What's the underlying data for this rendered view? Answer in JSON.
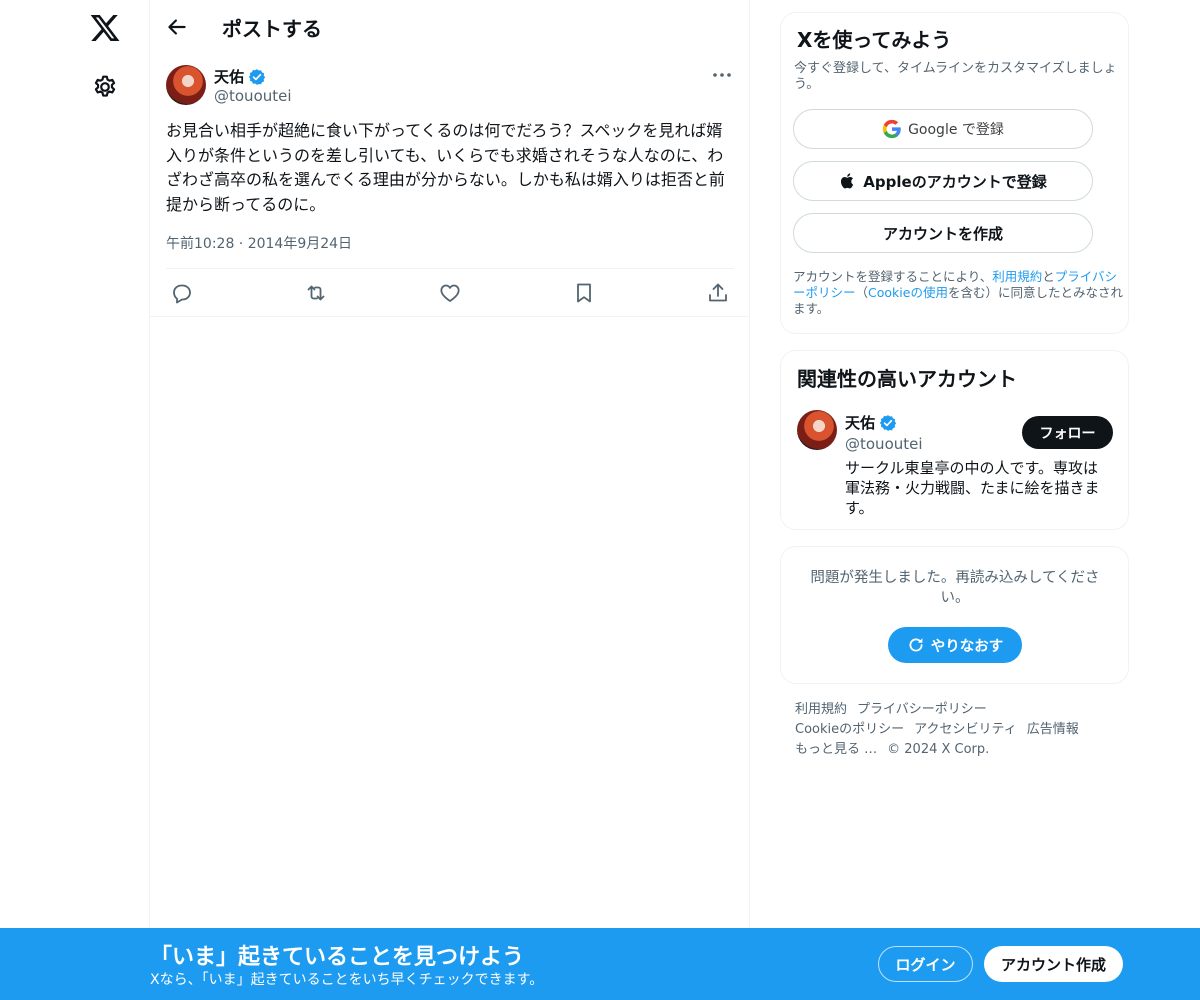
{
  "nav": {
    "logo_icon": "x-logo-icon",
    "settings_icon": "gear-icon"
  },
  "header": {
    "title": "ポストする",
    "back_icon": "arrow-left-icon"
  },
  "post": {
    "author_name": "天佑",
    "author_handle": "@tououtei",
    "verified": true,
    "text": "お見合い相手が超絶に食い下がってくるのは何でだろう？スペックを見れば婿入りが条件というのを差し引いても、いくらでも求婚されそうな人なのに、わざわざ高卒の私を選んでくる理由が分からない。しかも私は婿入りは拒否と前提から断ってるのに。",
    "timestamp": "午前10:28 · 2014年9月24日",
    "actions": [
      "reply-icon",
      "repost-icon",
      "like-icon",
      "bookmark-icon",
      "share-icon"
    ]
  },
  "signup_card": {
    "title": "Xを使ってみよう",
    "subtitle": "今すぐ登録して、タイムラインをカスタマイズしましょう。",
    "google_label": "Google で登録",
    "apple_label": "Appleのアカウントで登録",
    "create_label": "アカウントを作成",
    "legal_prefix": "アカウントを登録することにより、",
    "legal_terms": "利用規約",
    "legal_and": "と",
    "legal_privacy": "プライバシーポリシー",
    "legal_paren_open": "（",
    "legal_cookie": "Cookieの使用",
    "legal_suffix": "を含む）に同意したとみなされます。"
  },
  "related_card": {
    "title": "関連性の高いアカウント",
    "name": "天佑",
    "handle": "@tououtei",
    "follow_label": "フォロー",
    "bio": "サークル東皇亭の中の人です。専攻は軍法務・火力戦闘、たまに絵を描きます。"
  },
  "error_card": {
    "message": "問題が発生しました。再読み込みしてください。",
    "retry_label": "やりなおす"
  },
  "footer": {
    "links": [
      "利用規約",
      "プライバシーポリシー",
      "Cookieのポリシー",
      "アクセシビリティ",
      "広告情報",
      "もっと見る …"
    ],
    "copyright": "© 2024 X Corp."
  },
  "banner": {
    "title": "「いま」起きていることを見つけよう",
    "subtitle": "Xなら、「いま」起きていることをいち早くチェックできます。",
    "login_label": "ログイン",
    "signup_label": "アカウント作成"
  },
  "colors": {
    "accent": "#1d9bf0",
    "text": "#0f1419",
    "muted": "#536471",
    "border": "#eff3f4"
  }
}
